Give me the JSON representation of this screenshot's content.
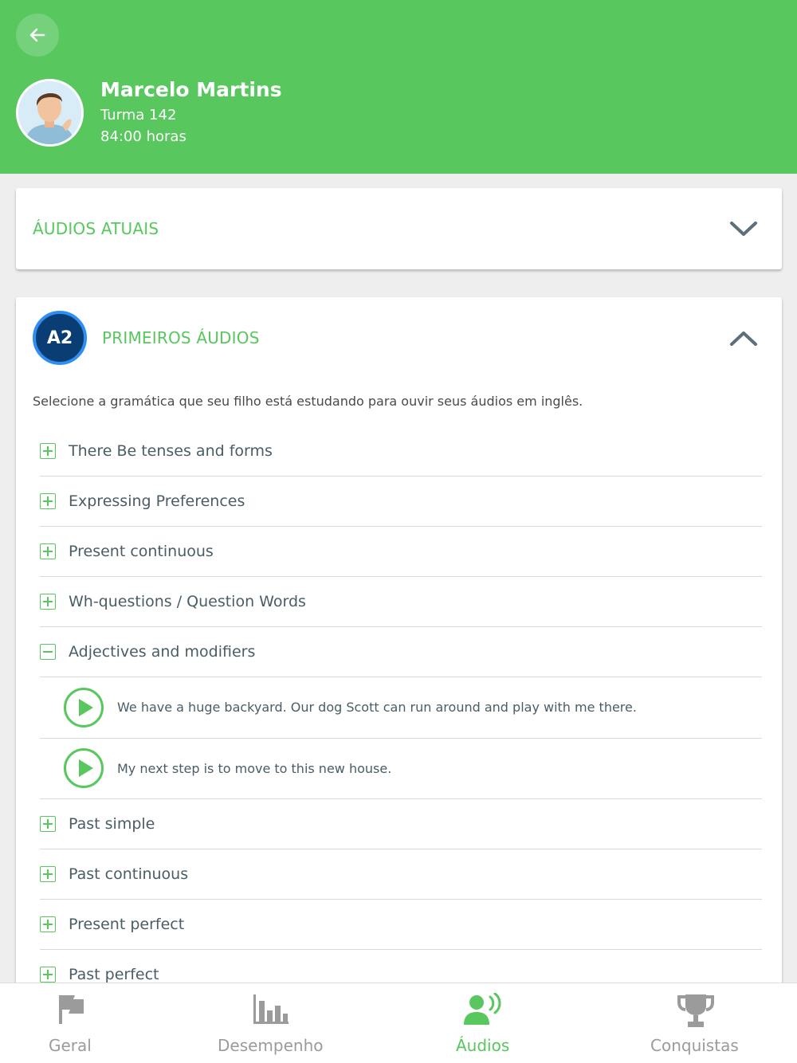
{
  "header": {
    "student_name": "Marcelo Martins",
    "class_label": "Turma 142",
    "hours_label": "84:00 horas",
    "background_color": "#57c75e"
  },
  "current_audios": {
    "title": "ÁUDIOS ATUAIS"
  },
  "first_audios": {
    "level": "A2",
    "title": "PRIMEIROS ÁUDIOS",
    "intro": "Selecione a gramática que seu filho está estudando para ouvir seus áudios em inglês.",
    "topics_before": [
      {
        "label": "There Be tenses and forms"
      },
      {
        "label": "Expressing Preferences"
      },
      {
        "label": "Present continuous"
      },
      {
        "label": "Wh-questions / Question Words"
      }
    ],
    "expanded_topic": {
      "label": "Adjectives and modifiers",
      "audios": [
        {
          "sentence": "We have a huge backyard. Our dog Scott can run around and play with me there."
        },
        {
          "sentence": "My next step is to move to this new house."
        }
      ]
    },
    "topics_after": [
      {
        "label": "Past simple"
      },
      {
        "label": "Past continuous"
      },
      {
        "label": "Present perfect"
      },
      {
        "label": "Past perfect"
      }
    ]
  },
  "tabs": [
    {
      "label": "Geral",
      "icon": "flag-icon",
      "active": false
    },
    {
      "label": "Desempenho",
      "icon": "bar-chart-icon",
      "active": false
    },
    {
      "label": "Áudios",
      "icon": "speaking-person-icon",
      "active": true
    },
    {
      "label": "Conquistas",
      "icon": "trophy-icon",
      "active": false
    }
  ],
  "colors": {
    "accent": "#57c75e",
    "badge": "#0a3d73",
    "badge_ring": "#2f8ef0",
    "inactive_tab": "#9b9b9b"
  }
}
